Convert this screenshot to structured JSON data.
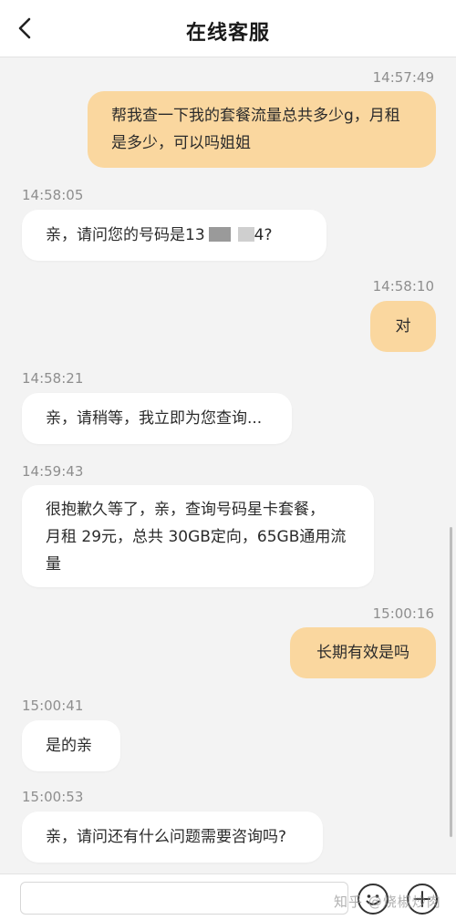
{
  "header": {
    "title": "在线客服",
    "back_icon": "chevron-left-icon"
  },
  "messages": [
    {
      "sender": "me",
      "time": "14:57:49",
      "lines": [
        "帮我查一下我的套餐流量总共多少g，月租",
        "是多少，可以吗姐姐"
      ]
    },
    {
      "sender": "agent",
      "time": "14:58:05",
      "text_prefix": "亲，请问您的号码是13",
      "text_suffix": "4?"
    },
    {
      "sender": "me",
      "time": "14:58:10",
      "text": "对"
    },
    {
      "sender": "agent",
      "time": "14:58:21",
      "text": "亲，请稍等，我立即为您查询..."
    },
    {
      "sender": "agent",
      "time": "14:59:43",
      "lines": [
        "很抱歉久等了，亲，查询号码星卡套餐，",
        "月租 29元，总共 30GB定向，65GB通用流",
        "量"
      ]
    },
    {
      "sender": "me",
      "time": "15:00:16",
      "text": "长期有效是吗"
    },
    {
      "sender": "agent",
      "time": "15:00:41",
      "text": "是的亲"
    },
    {
      "sender": "agent",
      "time": "15:00:53",
      "text": "亲，请问还有什么问题需要咨询吗?"
    }
  ],
  "input_bar": {
    "value": "",
    "emoji_icon": "emoji-icon",
    "more_icon": "plus-icon"
  },
  "watermark": "知乎 @烧椒炒肉",
  "colors": {
    "my_bubble": "#fad79f",
    "agent_bubble": "#ffffff",
    "background": "#f3f3f3",
    "timestamp": "#8e8e8e"
  }
}
